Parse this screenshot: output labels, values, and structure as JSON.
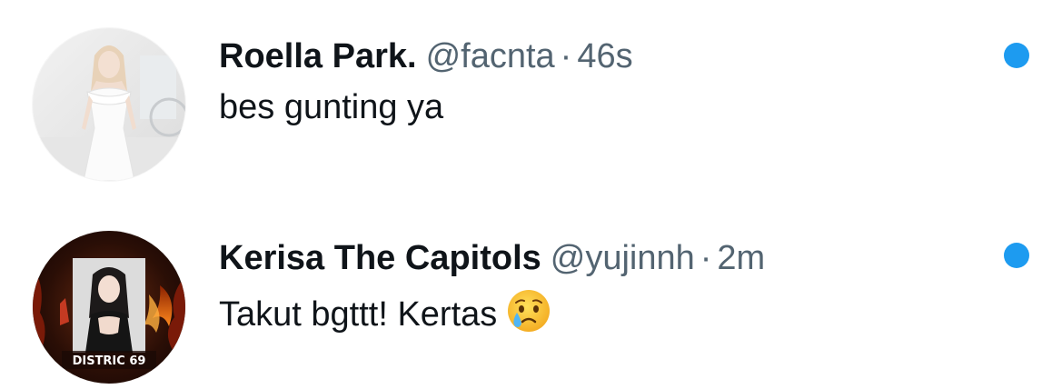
{
  "notifications": [
    {
      "display_name": "Roella Park.",
      "handle": "@facnta",
      "separator": "·",
      "time": "46s",
      "text": "bes gunting ya",
      "emoji": "",
      "avatar_icon": "avatar-woman-white-dress",
      "unread": true
    },
    {
      "display_name": "Kerisa The Capitols",
      "handle": "@yujinnh",
      "separator": "·",
      "time": "2m",
      "text": "Takut bgttt! Kertas",
      "emoji": "crying-face",
      "avatar_icon": "avatar-distric-69",
      "avatar_caption": "DISTRIC 69",
      "unread": true
    }
  ],
  "colors": {
    "name": "#0f1419",
    "meta": "#536471",
    "unread_dot": "#1d9bf0",
    "background": "#ffffff"
  }
}
